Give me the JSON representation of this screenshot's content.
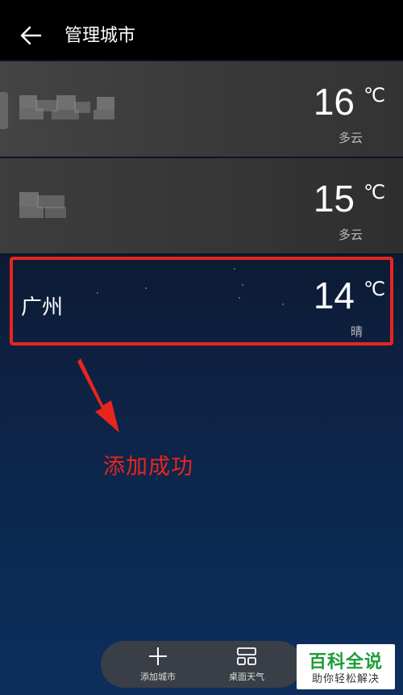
{
  "header": {
    "title": "管理城市"
  },
  "cities": [
    {
      "name": "",
      "temperature": "16",
      "unit": "℃",
      "condition": "多云"
    },
    {
      "name": "",
      "temperature": "15",
      "unit": "℃",
      "condition": "多云"
    },
    {
      "name": "广州",
      "temperature": "14",
      "unit": "℃",
      "condition": "晴"
    }
  ],
  "annotation": {
    "text": "添加成功",
    "color": "#e8251d"
  },
  "bottom_bar": {
    "add_city_label": "添加城市",
    "desktop_weather_label": "桌面天气"
  },
  "watermark": {
    "title": "百科全说",
    "subtitle": "助你轻松解决"
  },
  "icons": [
    "back-arrow-icon",
    "plus-icon",
    "widget-grid-icon"
  ]
}
